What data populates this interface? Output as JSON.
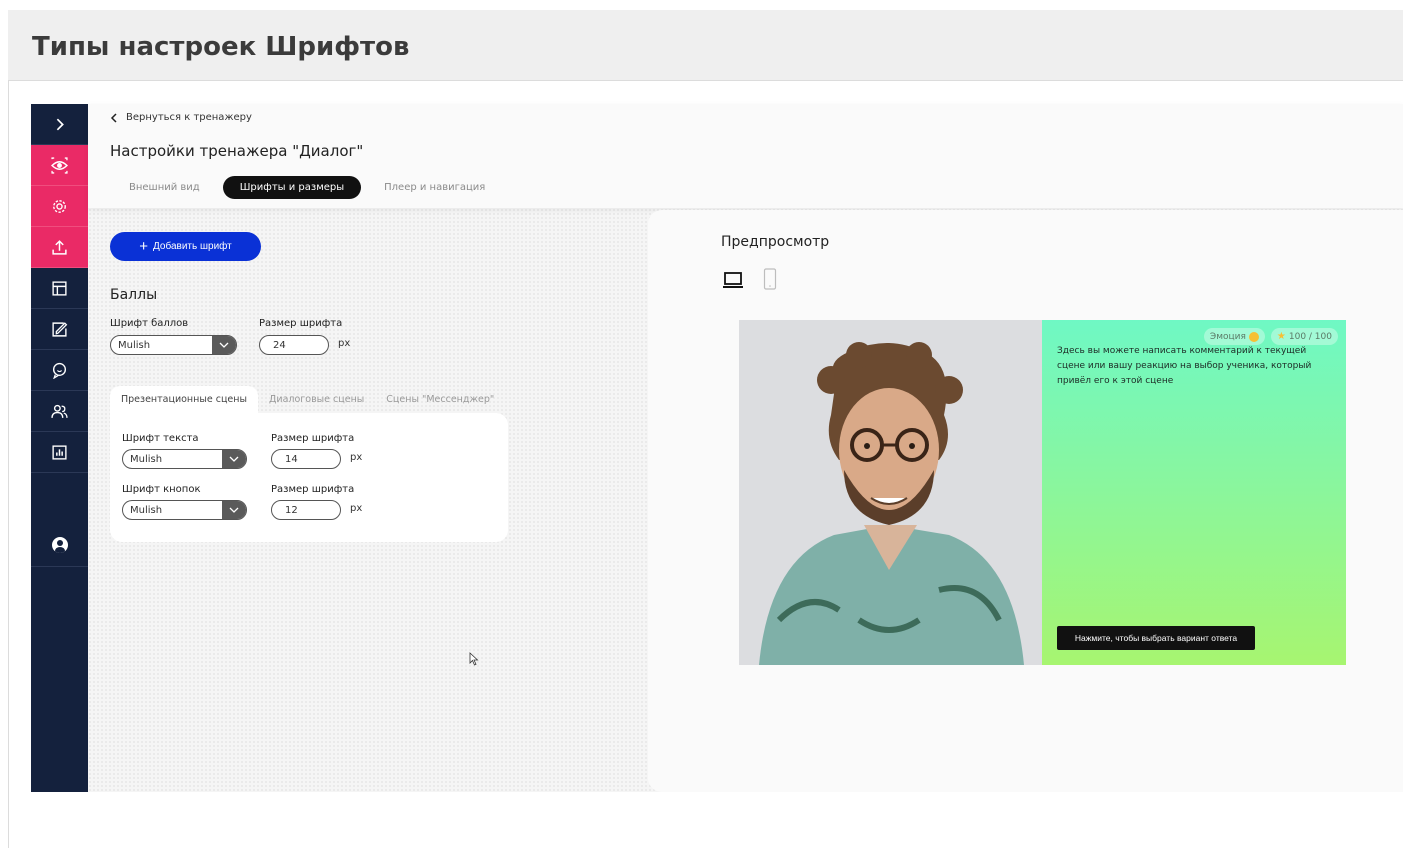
{
  "page": {
    "title": "Типы настроек Шрифтов"
  },
  "sidebar": {
    "items": [
      {
        "icon": "chevron-right-icon"
      },
      {
        "icon": "eye-icon",
        "color": "#ea2a66"
      },
      {
        "icon": "gear-icon",
        "color": "#ea2a66"
      },
      {
        "icon": "upload-icon",
        "color": "#ea2a66"
      },
      {
        "icon": "layout-icon"
      },
      {
        "icon": "edit-icon"
      },
      {
        "icon": "chat-icon"
      },
      {
        "icon": "users-icon"
      },
      {
        "icon": "analytics-icon"
      },
      {
        "icon": "avatar-icon"
      }
    ],
    "colors": {
      "bg": "#14213d",
      "accent": "#ea2a66"
    }
  },
  "header": {
    "back_label": "Вернуться к тренажеру",
    "settings_title": "Настройки тренажера \"Диалог\"",
    "tabs": [
      {
        "label": "Внешний вид",
        "active": false
      },
      {
        "label": "Шрифты и размеры",
        "active": true
      },
      {
        "label": "Плеер и навигация",
        "active": false
      }
    ]
  },
  "fonts": {
    "add_button_label": "Добавить шрифт",
    "add_button_color": "#0a31d6",
    "score_section": {
      "title": "Баллы",
      "font_label": "Шрифт баллов",
      "font_value": "Mulish",
      "size_label": "Размер шрифта",
      "size_value": "24",
      "unit": "px"
    },
    "scene_tabs": [
      {
        "label": "Презентационные сцены",
        "active": true
      },
      {
        "label": "Диалоговые сцены",
        "active": false
      },
      {
        "label": "Сцены \"Мессенджер\"",
        "active": false
      }
    ],
    "text_font": {
      "font_label": "Шрифт текста",
      "font_value": "Mulish",
      "size_label": "Размер шрифта",
      "size_value": "14",
      "unit": "px"
    },
    "button_font": {
      "font_label": "Шрифт кнопок",
      "font_value": "Mulish",
      "size_label": "Размер шрифта",
      "size_value": "12",
      "unit": "px"
    }
  },
  "preview": {
    "title": "Предпросмотр",
    "devices": [
      "laptop-icon",
      "phone-icon"
    ],
    "emotion_label": "Эмоция",
    "score_label": "100 / 100",
    "comment": "Здесь вы можете написать комментарий к текущей сцене или вашу реакцию на выбор ученика, который привёл его к этой сцене",
    "choose_button_label": "Нажмите, чтобы выбрать вариант ответа",
    "gradient_colors": [
      "#6ff8c4",
      "#a7f570"
    ]
  }
}
